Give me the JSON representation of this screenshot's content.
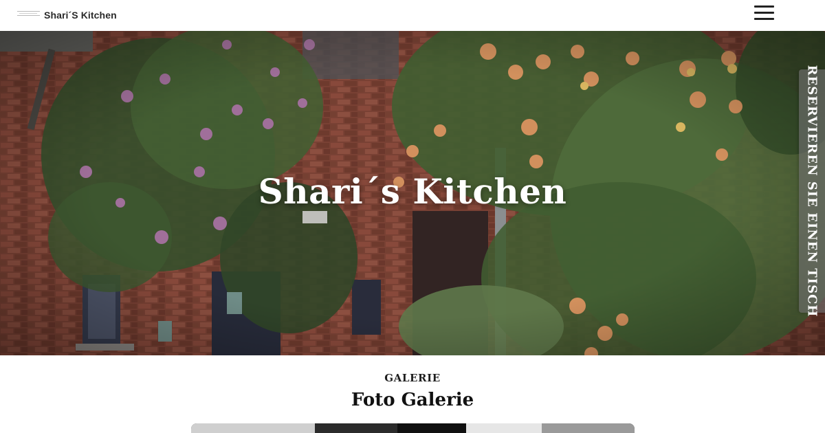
{
  "header": {
    "brand": "Shari´S Kitchen",
    "menu_icon": "hamburger-menu-icon"
  },
  "hero": {
    "title": "Shari´s Kitchen",
    "image": "brick building facade covered with flowering vines"
  },
  "reserve_tab": {
    "label": "RESERVIEREN SIE EINEN TISCH"
  },
  "gallery": {
    "eyebrow": "GALERIE",
    "title": "Foto Galerie"
  }
}
